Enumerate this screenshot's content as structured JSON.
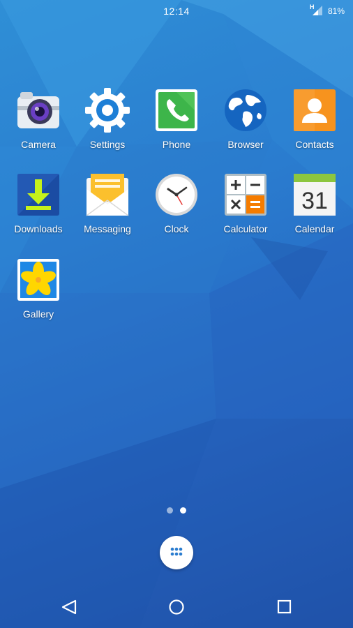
{
  "status_bar": {
    "time": "12:14",
    "network_type": "H",
    "battery": "81%"
  },
  "apps": [
    {
      "label": "Camera",
      "icon": "camera-icon"
    },
    {
      "label": "Settings",
      "icon": "settings-gear-icon"
    },
    {
      "label": "Phone",
      "icon": "phone-icon"
    },
    {
      "label": "Browser",
      "icon": "globe-icon"
    },
    {
      "label": "Contacts",
      "icon": "contacts-person-icon"
    },
    {
      "label": "Downloads",
      "icon": "download-arrow-icon"
    },
    {
      "label": "Messaging",
      "icon": "envelope-icon"
    },
    {
      "label": "Clock",
      "icon": "clock-icon"
    },
    {
      "label": "Calculator",
      "icon": "calculator-icon"
    },
    {
      "label": "Calendar",
      "icon": "calendar-icon",
      "badge": "31"
    },
    {
      "label": "Gallery",
      "icon": "gallery-flower-icon"
    }
  ],
  "page_indicator": {
    "pages": 2,
    "current": 2
  },
  "nav": {
    "back": "back-triangle-icon",
    "home": "home-circle-icon",
    "recents": "recents-square-icon"
  },
  "colors": {
    "wallpaper": "#2a7ccf",
    "phone_green": "#3db54a",
    "contacts_orange": "#f7931e",
    "calendar_green": "#8cc63f"
  }
}
